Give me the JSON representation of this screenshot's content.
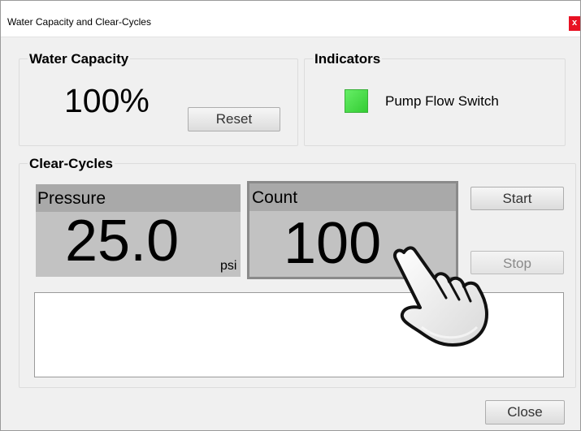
{
  "window": {
    "title": "Water Capacity and Clear-Cycles",
    "close_label": "x"
  },
  "water_capacity": {
    "legend": "Water Capacity",
    "value": "100%",
    "reset_label": "Reset"
  },
  "indicators": {
    "legend": "Indicators",
    "pump_flow_switch_label": "Pump Flow Switch",
    "pump_flow_switch_color": "#44dd44"
  },
  "clear_cycles": {
    "legend": "Clear-Cycles",
    "pressure": {
      "label": "Pressure",
      "value": "25.0",
      "unit": "psi"
    },
    "count": {
      "label": "Count",
      "value": "100"
    },
    "start_label": "Start",
    "stop_label": "Stop",
    "log_text": ""
  },
  "footer": {
    "close_label": "Close"
  },
  "pointer": {
    "icon": "hand-pointer-icon"
  }
}
